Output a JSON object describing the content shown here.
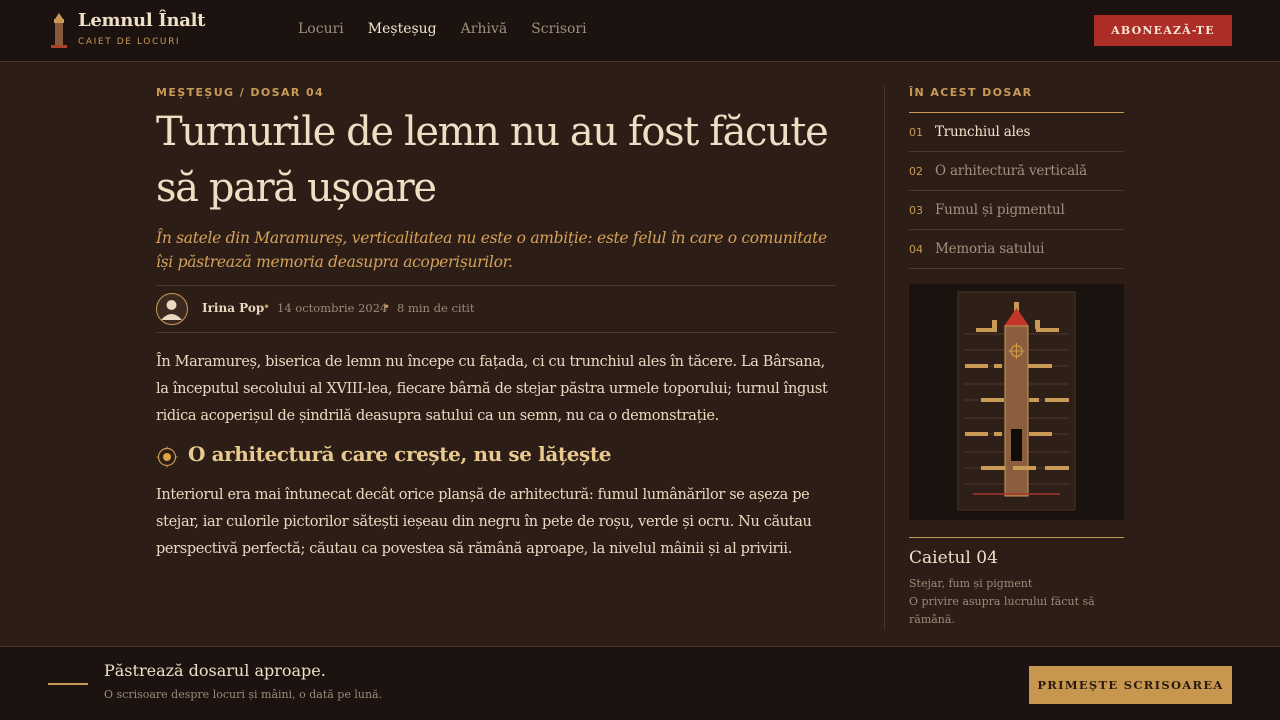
{
  "brand": {
    "name": "Lemnul Înalt",
    "tagline": "CAIET DE LOCURI",
    "logo_icon": "wooden-tower-icon"
  },
  "nav": {
    "items": [
      {
        "label": "Locuri",
        "active": false
      },
      {
        "label": "Meșteșug",
        "active": true
      },
      {
        "label": "Arhivă",
        "active": false
      },
      {
        "label": "Scrisori",
        "active": false
      }
    ],
    "subscribe_label": "ABONEAZĂ-TE"
  },
  "article": {
    "kicker": "MEȘTEȘUG / DOSAR 04",
    "title": "Turnurile de lemn nu au fost făcute să pară ușoare",
    "dek": "În satele din Maramureș, verticalitatea nu este o ambiție: este felul în care o comunitate își păstrează memoria deasupra acoperișurilor.",
    "author": "Irina Pop",
    "date": "14 octombrie 2024",
    "read_time": "8 min de citit",
    "paragraph_1": "În Maramureș, biserica de lemn nu începe cu fațada, ci cu trunchiul ales în tăcere. La Bârsana, la începutul secolului al XVIII-lea, fiecare bârnă de stejar păstra urmele toporului; turnul îngust ridica acoperișul de șindrilă deasupra satului ca un semn, nu ca o demonstrație.",
    "section_title": "O arhitectură care crește, nu se lățește",
    "paragraph_2": "Interiorul era mai întunecat decât orice planșă de arhitectură: fumul lumânărilor se așeza pe stejar, iar culorile pictorilor sătești ieșeau din negru în pete de roșu, verde și ocru. Nu căutau perspectivă perfectă; căutau ca povestea să rămână aproape, la nivelul mâinii și al privirii."
  },
  "sidebar": {
    "heading": "ÎN ACEST DOSAR",
    "toc": [
      {
        "num": "01",
        "label": "Trunchiul ales",
        "active": true
      },
      {
        "num": "02",
        "label": "O arhitectură verticală",
        "active": false
      },
      {
        "num": "03",
        "label": "Fumul și pigmentul",
        "active": false
      },
      {
        "num": "04",
        "label": "Memoria satului",
        "active": false
      }
    ],
    "caption_title": "Caietul 04",
    "caption_sub": "Stejar, fum și pigment",
    "caption_desc": "O privire asupra lucrului făcut să rămână."
  },
  "footer": {
    "title": "Păstrează dosarul aproape.",
    "subtitle": "O scrisoare despre locuri și mâini, o dată pe lună.",
    "button_label": "PRIMEȘTE SCRISOAREA"
  },
  "colors": {
    "background": "#2c1e17",
    "header": "#1c1310",
    "accent_gold": "#c99a55",
    "accent_red": "#ad2e26",
    "text_light": "#eedfc4"
  }
}
